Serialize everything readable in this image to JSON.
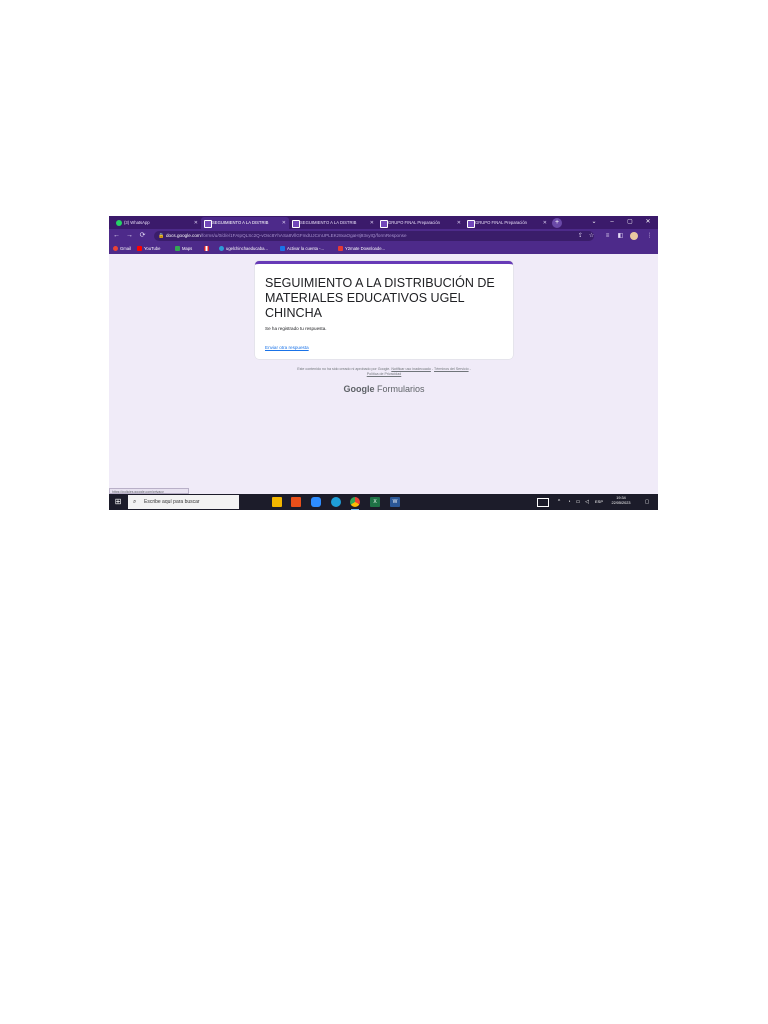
{
  "browser": {
    "tabs": [
      {
        "label": "(3) WhatsApp",
        "favicon": "whatsapp-icon",
        "color": "#25d366",
        "active": false
      },
      {
        "label": "SEGUIMIENTO A LA DISTRIB",
        "favicon": "forms-icon",
        "color": "#7248b9",
        "active": true
      },
      {
        "label": "SEGUIMIENTO A LA DISTRIB",
        "favicon": "forms-icon",
        "color": "#7248b9",
        "active": false
      },
      {
        "label": "GRUPO FINAL Preparación",
        "favicon": "forms-icon",
        "color": "#7248b9",
        "active": false
      },
      {
        "label": "GRUPO FINAL Preparación",
        "favicon": "forms-icon",
        "color": "#7248b9",
        "active": false
      }
    ],
    "new_tab_icon": "+",
    "window_controls": {
      "chevron": "⌄",
      "minimize": "–",
      "maximize": "▢",
      "close": "✕"
    },
    "address": {
      "domain": "docs.google.com",
      "path": "/forms/u/0/d/e/1FAIpQLSc2Q-vOsc8YhASa8VllGFmdUJCmUPLEKz8xaOgaHIj93vyIQ/formResponse"
    },
    "bookmarks": [
      {
        "label": "Gmail",
        "color": "#ea4335"
      },
      {
        "label": "YouTube",
        "color": "#ff0000"
      },
      {
        "label": "Maps",
        "color": "#34a853"
      },
      {
        "label": "",
        "color": "#d91f26"
      },
      {
        "label": "ugelchinchaeducaba...",
        "color": "#2e9bd6"
      },
      {
        "label": "Activar la cuenta -...",
        "color": "#1a73e8"
      },
      {
        "label": "Y2mate Downloade...",
        "color": "#e53935"
      }
    ]
  },
  "form": {
    "title": "SEGUIMIENTO A LA DISTRIBUCIÓN DE MATERIALES EDUCATIVOS UGEL CHINCHA",
    "message": "Se ha registrado tu respuesta.",
    "another_link": "Enviar otra respuesta",
    "accent": "#673ab7"
  },
  "footer": {
    "disclaimer_prefix": "Este contenido no ha sido creado ni aprobado por Google.",
    "report_link": "Notificar uso inadecuado",
    "sep1": " - ",
    "terms_link": "Términos del Servicio",
    "sep2": " - ",
    "privacy_link": "Política de Privacidad",
    "brand_google": "Google",
    "brand_product": "Formularios"
  },
  "status_bar": "https://policies.google.com/privacy",
  "taskbar": {
    "search_placeholder": "Escribe aquí para buscar",
    "apps": [
      {
        "name": "file-explorer",
        "color": "#f2b600"
      },
      {
        "name": "store",
        "color": "#e84f1a"
      },
      {
        "name": "zoom",
        "color": "#2d8cff"
      },
      {
        "name": "edge",
        "color": "#1f9fd8"
      },
      {
        "name": "chrome",
        "color": "#f2b600"
      },
      {
        "name": "excel",
        "color": "#1e7145"
      },
      {
        "name": "word",
        "color": "#2b5797"
      }
    ],
    "language": "ESP",
    "time": "19:34",
    "date": "22/05/2023"
  }
}
